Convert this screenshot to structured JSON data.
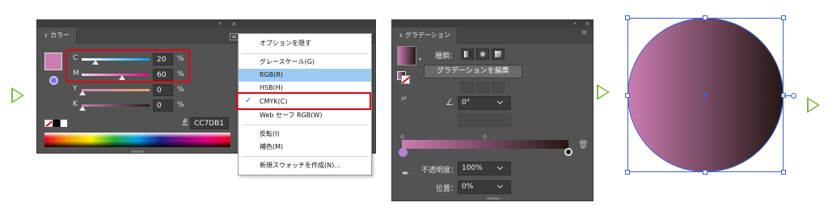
{
  "color_panel": {
    "tab_label": "カラー",
    "sliders": [
      {
        "label": "C",
        "value": "20",
        "unit": "%",
        "level": 0.2
      },
      {
        "label": "M",
        "value": "60",
        "unit": "%",
        "level": 0.6
      },
      {
        "label": "Y",
        "value": "0",
        "unit": "%",
        "level": 0.0
      },
      {
        "label": "K",
        "value": "0",
        "unit": "%",
        "level": 0.0
      }
    ],
    "hex_value": "CC7DB1",
    "hex_symbol": "#",
    "fill_color": "#cc7db1",
    "accent": "#e60012"
  },
  "menu": {
    "items": [
      {
        "label": "オプションを隠す"
      },
      {
        "label": "グレースケール(G)"
      },
      {
        "label": "RGB(R)",
        "highlighted": true
      },
      {
        "label": "HSB(H)"
      },
      {
        "label": "CMYK(C)",
        "checked": true
      },
      {
        "label": "Web セーフ RGB(W)"
      },
      {
        "label": "反転(I)"
      },
      {
        "label": "補色(M)"
      },
      {
        "label": "新規スウォッチを作成(N)..."
      }
    ],
    "highlight_color": "#9dcaf1"
  },
  "gradient_panel": {
    "tab_label": "グラデーション",
    "type_label": "種類：",
    "edit_button": "グラデーションを編集",
    "angle_value": "0°",
    "opacity_label": "不透明度：",
    "opacity_value": "100%",
    "location_label": "位置：",
    "location_value": "0%",
    "gradient_start": "#cc7db1",
    "gradient_end": "#231815"
  },
  "canvas": {
    "selection_color": "#3b63d6",
    "circle_start": "#cc7db1",
    "circle_end": "#231815"
  },
  "flow_arrow_color": "#7cbc3c"
}
